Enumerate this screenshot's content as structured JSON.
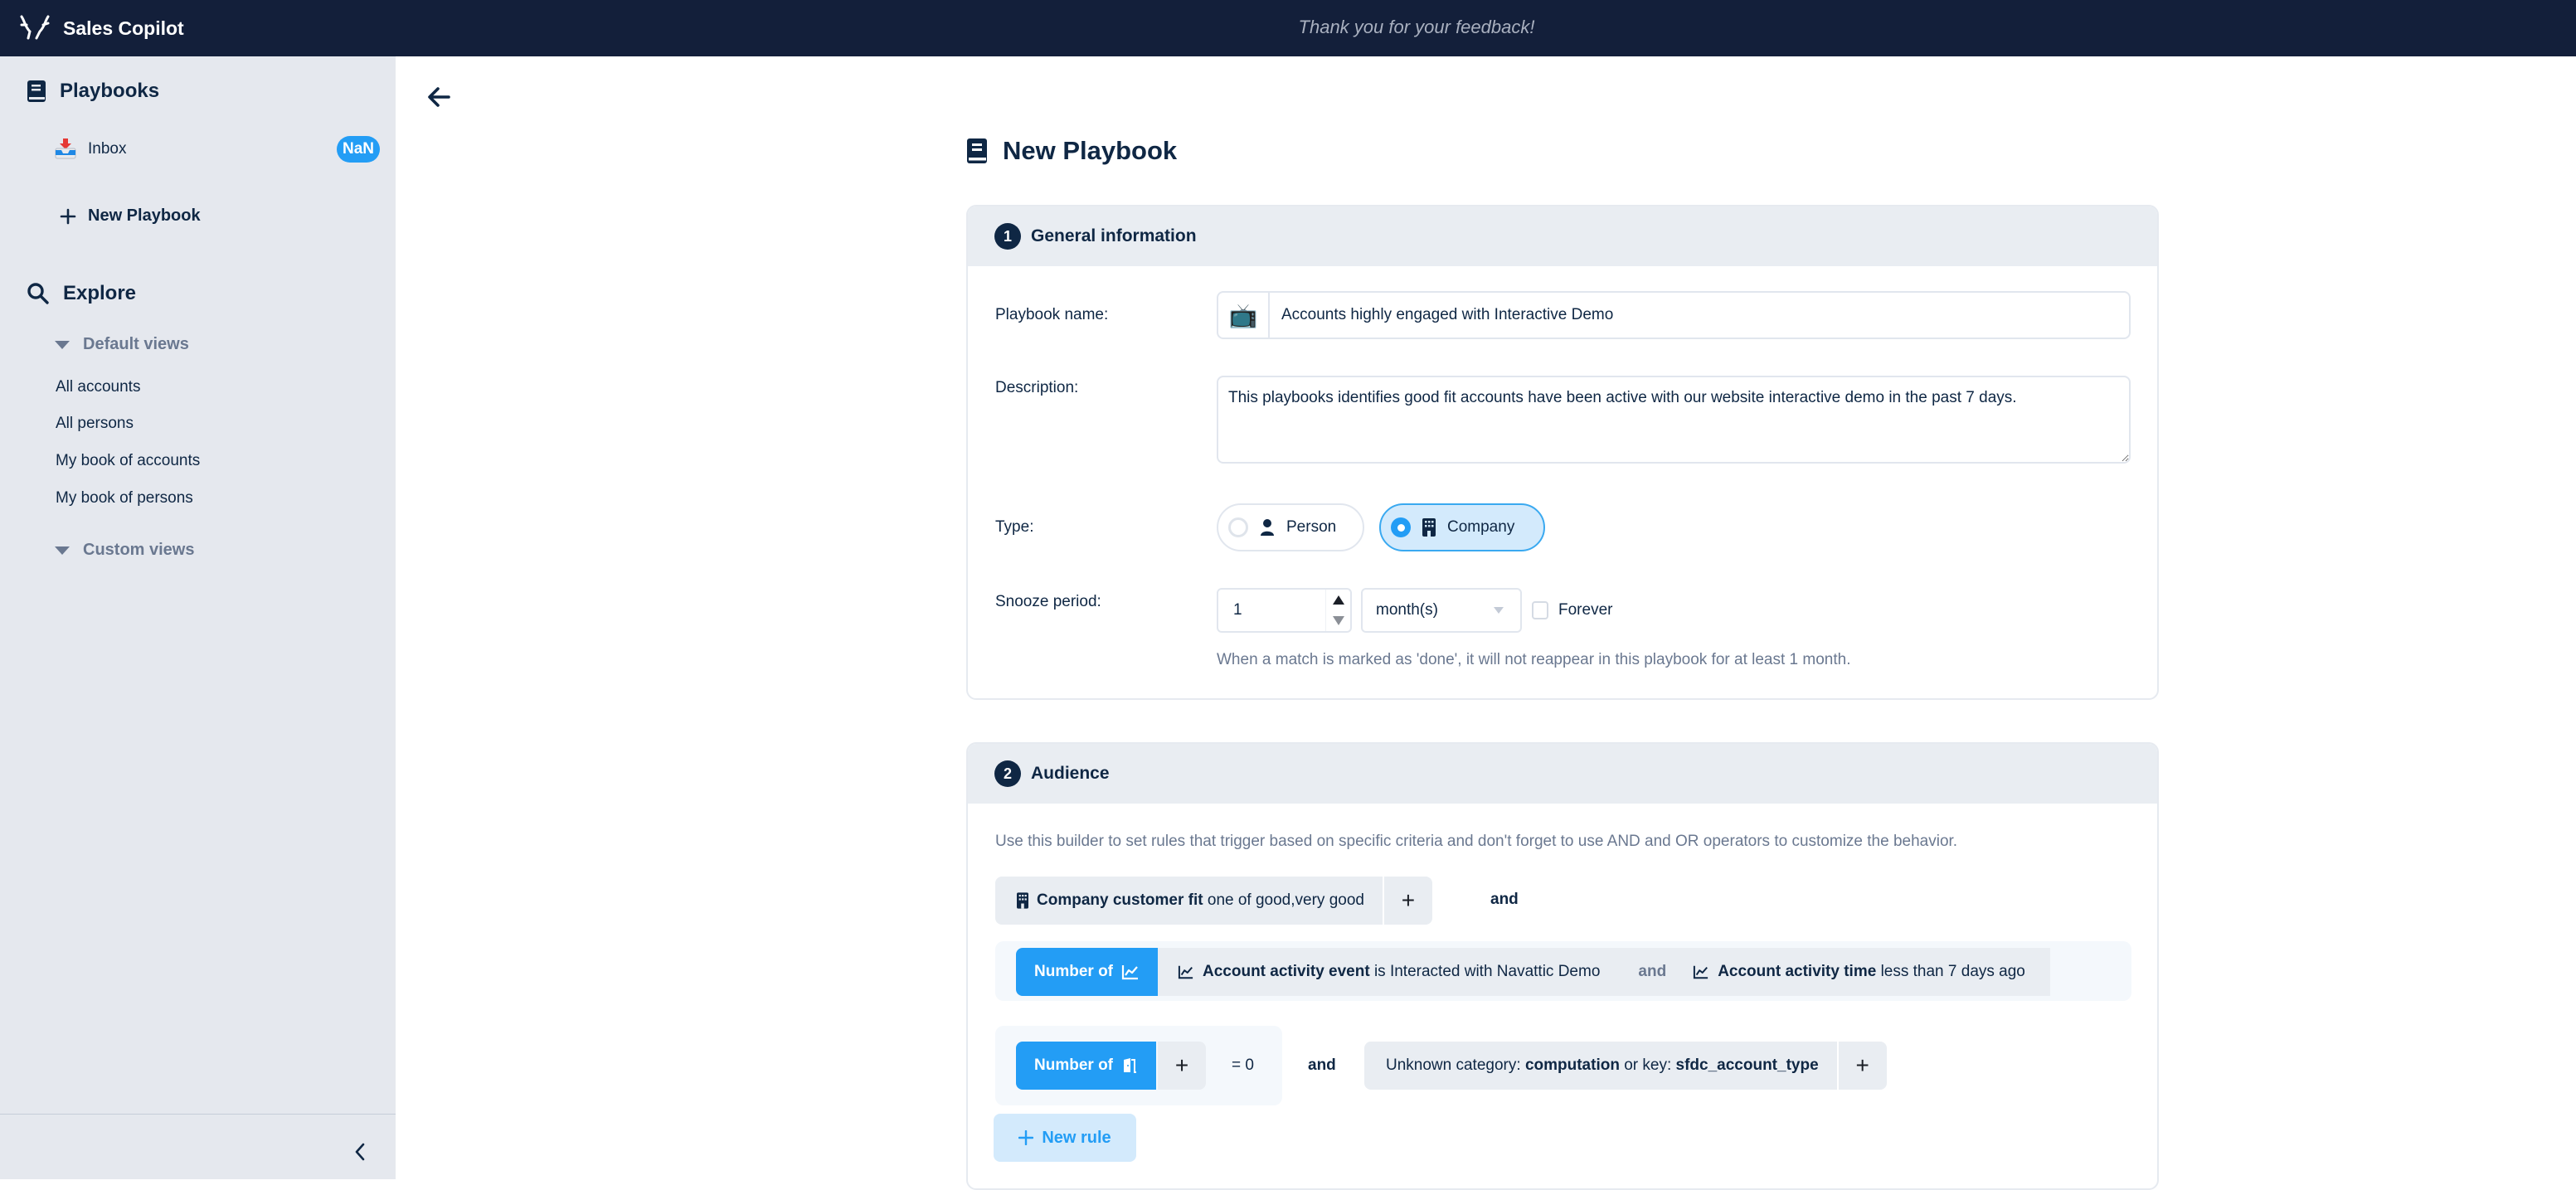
{
  "app": {
    "name": "Sales Copilot",
    "feedback_message": "Thank you for your feedback!"
  },
  "sidebar": {
    "playbooks_title": "Playbooks",
    "inbox_label": "Inbox",
    "inbox_badge": "NaN",
    "new_playbook_label": "New Playbook",
    "explore_title": "Explore",
    "default_views_label": "Default views",
    "default_views": [
      {
        "label": "All accounts"
      },
      {
        "label": "All persons"
      },
      {
        "label": "My book of accounts"
      },
      {
        "label": "My book of persons"
      }
    ],
    "custom_views_label": "Custom views"
  },
  "page": {
    "title": "New Playbook"
  },
  "general": {
    "step": "1",
    "title": "General information",
    "name_label": "Playbook name:",
    "name_emoji": "📺",
    "name_value": "Accounts highly engaged with Interactive Demo",
    "description_label": "Description:",
    "description_value": "This playbooks identifies good fit accounts have been active with our website interactive demo in the past 7 days.",
    "type_label": "Type:",
    "type_options": [
      {
        "label": "Person",
        "selected": false
      },
      {
        "label": "Company",
        "selected": true
      }
    ],
    "snooze_label": "Snooze period:",
    "snooze_value": "1",
    "snooze_unit": "month(s)",
    "forever_label": "Forever",
    "forever_checked": false,
    "snooze_hint": "When a match is marked as 'done', it will not reappear in this playbook for at least 1 month."
  },
  "audience": {
    "step": "2",
    "title": "Audience",
    "intro": "Use this builder to set rules that trigger based on specific criteria and don't forget to use AND and OR operators to customize the behavior.",
    "rule1": {
      "field": "Company customer fit",
      "condition": "one of good,very good",
      "connector": "and"
    },
    "rule2": {
      "aggregate_label": "Number of",
      "cond1_field": "Account activity event",
      "cond1_value": "is Interacted with Navattic Demo",
      "connector": "and",
      "cond2_field": "Account activity time",
      "cond2_value": "less than 7 days ago"
    },
    "rule3": {
      "aggregate_label": "Number of",
      "comparison": "= 0",
      "connector": "and",
      "unknown_prefix": "Unknown category:",
      "unknown_category": "computation",
      "unknown_mid": "or key:",
      "unknown_key": "sfdc_account_type"
    },
    "new_rule_label": "New rule"
  },
  "colors": {
    "header_bg": "#131f3a",
    "sidebar_bg": "#e5e8ee",
    "accent": "#239df5",
    "text_primary": "#0f2744",
    "text_muted": "#6a7890"
  }
}
